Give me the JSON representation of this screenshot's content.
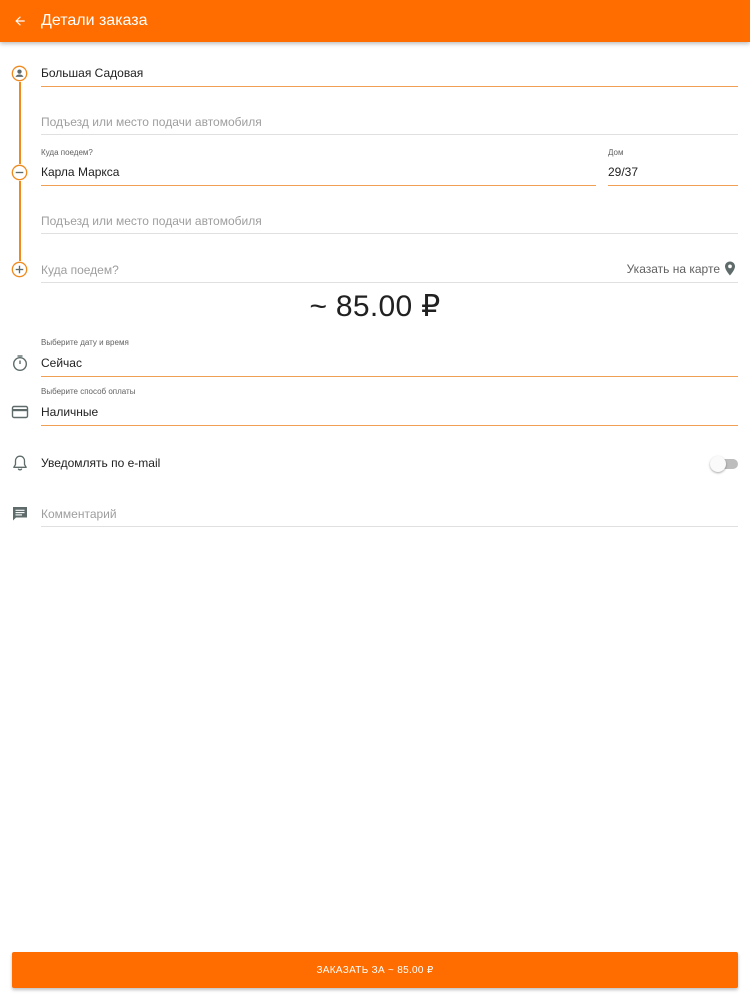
{
  "header": {
    "title": "Детали заказа",
    "back_icon": "arrow-left-icon"
  },
  "route": {
    "origin": {
      "street": "Большая Садовая",
      "entrance_placeholder": "Подъезд или место подачи автомобиля"
    },
    "destination": {
      "street_label": "Куда поедем?",
      "street": "Карла Маркса",
      "house_label": "Дом",
      "house": "29/37",
      "entrance_placeholder": "Подъезд или место подачи автомобиля"
    },
    "add_stop_placeholder": "Куда поедем?",
    "map_link": "Указать на карте"
  },
  "price": "~ 85.00 ₽",
  "datetime": {
    "label": "Выберите дату и время",
    "value": "Сейчас"
  },
  "payment": {
    "label": "Выберите способ оплаты",
    "value": "Наличные"
  },
  "notify": {
    "label": "Уведомлять по e-mail",
    "enabled": false
  },
  "comment": {
    "placeholder": "Комментарий"
  },
  "order_button": "ЗАКАЗАТЬ ЗА ~ 85.00 ₽",
  "colors": {
    "accent": "#ff6d00",
    "route_line": "#ef8a1f"
  }
}
